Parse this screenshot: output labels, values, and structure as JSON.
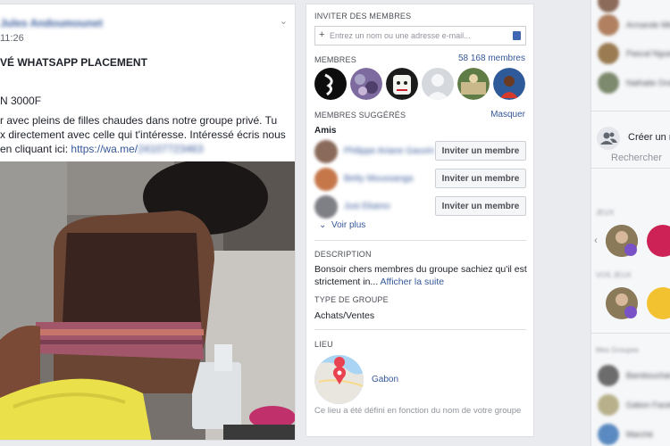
{
  "post": {
    "author": "Jules Andoumounet",
    "time": "11:26",
    "title": "VÉ WHATSAPP PLACEMENT",
    "price": "N 3000F",
    "body_line1": "r avec pleins de filles chaudes dans notre groupe privé. Tu",
    "body_line2": "x directement avec celle qui t'intéresse. Intéressé écris nous",
    "body_line3": "en cliquant ici: ",
    "link_text": "https://wa.me/",
    "link_blurred": "24107723463"
  },
  "sidebar": {
    "invite": {
      "title": "INVITER DES MEMBRES",
      "placeholder": "Entrez un nom ou une adresse e-mail..."
    },
    "members": {
      "title": "MEMBRES",
      "count": "58 168 membres"
    },
    "suggested": {
      "title": "MEMBRES SUGGÉRÉS",
      "hide": "Masquer",
      "friends_label": "Amis",
      "items": [
        {
          "name": "Philippe Ariane Gauvin",
          "button": "Inviter un membre"
        },
        {
          "name": "Betty Moussanga",
          "button": "Inviter un membre"
        },
        {
          "name": "Jusi Ekamo",
          "button": "Inviter un membre"
        }
      ],
      "see_more": "Voir plus"
    },
    "description": {
      "title": "DESCRIPTION",
      "text": "Bonsoir chers membres du groupe sachiez qu'il est strictement in...",
      "more": "Afficher la suite"
    },
    "group_type": {
      "title": "TYPE DE GROUPE",
      "value": "Achats/Ventes"
    },
    "location": {
      "title": "LIEU",
      "place": "Gabon",
      "note": "Ce lieu a été défini en fonction du nom de votre groupe"
    }
  },
  "chat": {
    "top_items": [
      "Armande Mbou",
      "Pascal Nguema",
      "Nathalie Ondo"
    ],
    "create": "Créer un n",
    "search": "Rechercher",
    "section1": "JEUX",
    "section2": "VOS JEUX",
    "section3": "Mes Groupes",
    "bottom_items": [
      "Bambouchat",
      "Gabon Facebook",
      "Marché"
    ]
  },
  "colors": {
    "link": "#365899",
    "accent": "#4267b2",
    "background": "#e9ebee"
  }
}
